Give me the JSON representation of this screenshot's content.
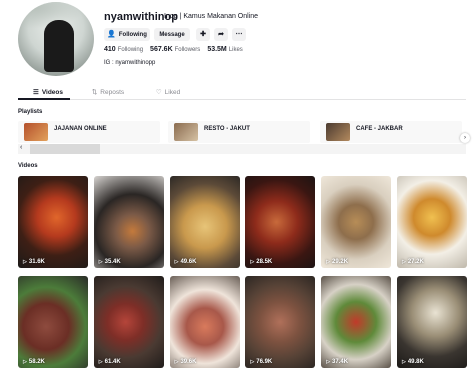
{
  "profile": {
    "username": "nyamwithinop",
    "nickname": "Inop | Kamus Makanan Online",
    "following_button": "Following",
    "message_button": "Message",
    "following_count": "410",
    "following_label": "Following",
    "followers_count": "567.6K",
    "followers_label": "Followers",
    "likes_count": "53.5M",
    "likes_label": "Likes",
    "bio": "IG : nyamwithinopp"
  },
  "tabs": [
    {
      "label": "Videos",
      "icon": "grid-icon",
      "active": true
    },
    {
      "label": "Reposts",
      "icon": "repost-icon",
      "active": false
    },
    {
      "label": "Liked",
      "icon": "heart-icon",
      "active": false
    }
  ],
  "playlists_title": "Playlists",
  "playlists": [
    {
      "title": "JAJANAN ONLINE"
    },
    {
      "title": "RESTO - JAKUT"
    },
    {
      "title": "CAFE - JAKBAR"
    }
  ],
  "videos_title": "Videos",
  "videos": [
    {
      "views": "31.6K"
    },
    {
      "views": "35.4K"
    },
    {
      "views": "49.6K"
    },
    {
      "views": "28.5K"
    },
    {
      "views": "29.2K"
    },
    {
      "views": "27.2K"
    },
    {
      "views": "58.2K"
    },
    {
      "views": "61.4K"
    },
    {
      "views": "39.6K"
    },
    {
      "views": "76.9K"
    },
    {
      "views": "37.4K"
    },
    {
      "views": "49.8K"
    }
  ],
  "colors": {
    "text": "#161823",
    "muted": "#8a8b91",
    "button_bg": "#f1f1f2"
  }
}
